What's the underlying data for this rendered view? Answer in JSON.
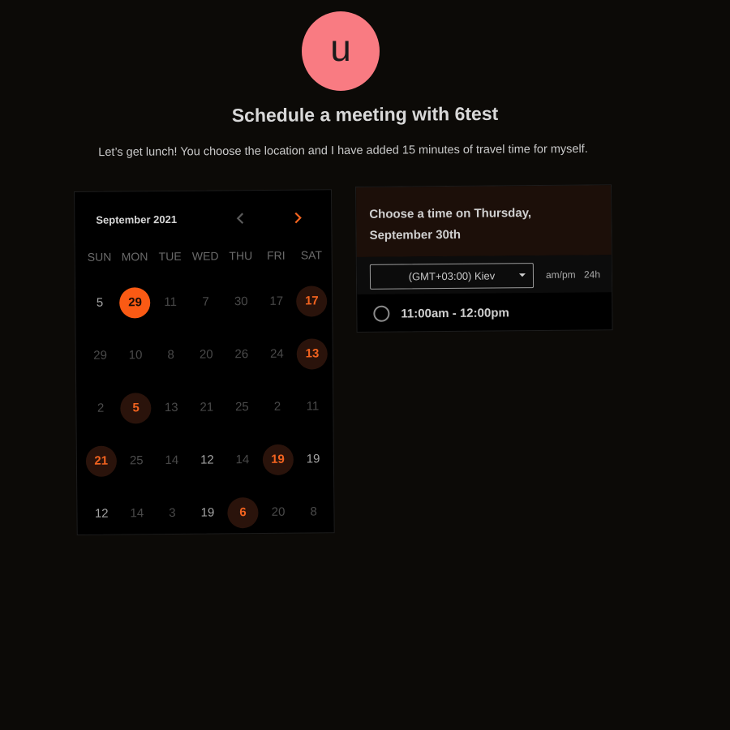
{
  "header": {
    "avatar_letter": "u",
    "title": "Schedule a meeting with 6test",
    "subtitle": "Let’s get lunch! You choose the location and I have added 15 minutes of travel time for myself."
  },
  "calendar": {
    "month_label": "September 2021",
    "prev_icon": "chevron-left-icon",
    "next_icon": "chevron-right-icon",
    "weekdays": [
      "SUN",
      "MON",
      "TUE",
      "WED",
      "THU",
      "FRI",
      "SAT"
    ],
    "days": [
      {
        "label": "5",
        "state": "active"
      },
      {
        "label": "29",
        "state": "selected"
      },
      {
        "label": "11",
        "state": "disabled"
      },
      {
        "label": "7",
        "state": "disabled"
      },
      {
        "label": "30",
        "state": "disabled"
      },
      {
        "label": "17",
        "state": "disabled"
      },
      {
        "label": "17",
        "state": "available"
      },
      {
        "label": "29",
        "state": "disabled"
      },
      {
        "label": "10",
        "state": "disabled"
      },
      {
        "label": "8",
        "state": "disabled"
      },
      {
        "label": "20",
        "state": "disabled"
      },
      {
        "label": "26",
        "state": "disabled"
      },
      {
        "label": "24",
        "state": "disabled"
      },
      {
        "label": "13",
        "state": "available"
      },
      {
        "label": "2",
        "state": "disabled"
      },
      {
        "label": "5",
        "state": "available"
      },
      {
        "label": "13",
        "state": "disabled"
      },
      {
        "label": "21",
        "state": "disabled"
      },
      {
        "label": "25",
        "state": "disabled"
      },
      {
        "label": "2",
        "state": "disabled"
      },
      {
        "label": "11",
        "state": "disabled"
      },
      {
        "label": "21",
        "state": "available"
      },
      {
        "label": "25",
        "state": "disabled"
      },
      {
        "label": "14",
        "state": "disabled"
      },
      {
        "label": "12",
        "state": "active"
      },
      {
        "label": "14",
        "state": "disabled"
      },
      {
        "label": "19",
        "state": "available"
      },
      {
        "label": "19",
        "state": "active"
      },
      {
        "label": "12",
        "state": "active"
      },
      {
        "label": "14",
        "state": "disabled"
      },
      {
        "label": "3",
        "state": "disabled"
      },
      {
        "label": "19",
        "state": "active"
      },
      {
        "label": "6",
        "state": "available"
      },
      {
        "label": "20",
        "state": "disabled"
      },
      {
        "label": "8",
        "state": "disabled"
      }
    ]
  },
  "time_panel": {
    "title": "Choose a time on Thursday, September 30th",
    "timezone": "(GMT+03:00) Kiev",
    "format_ampm": "am/pm",
    "format_24h": "24h",
    "slots": [
      "11:00am - 12:00pm"
    ]
  },
  "colors": {
    "background": "#0c0a07",
    "accent": "#fa5a14",
    "avatar": "#f97b82",
    "available_bg": "#2a130b"
  }
}
